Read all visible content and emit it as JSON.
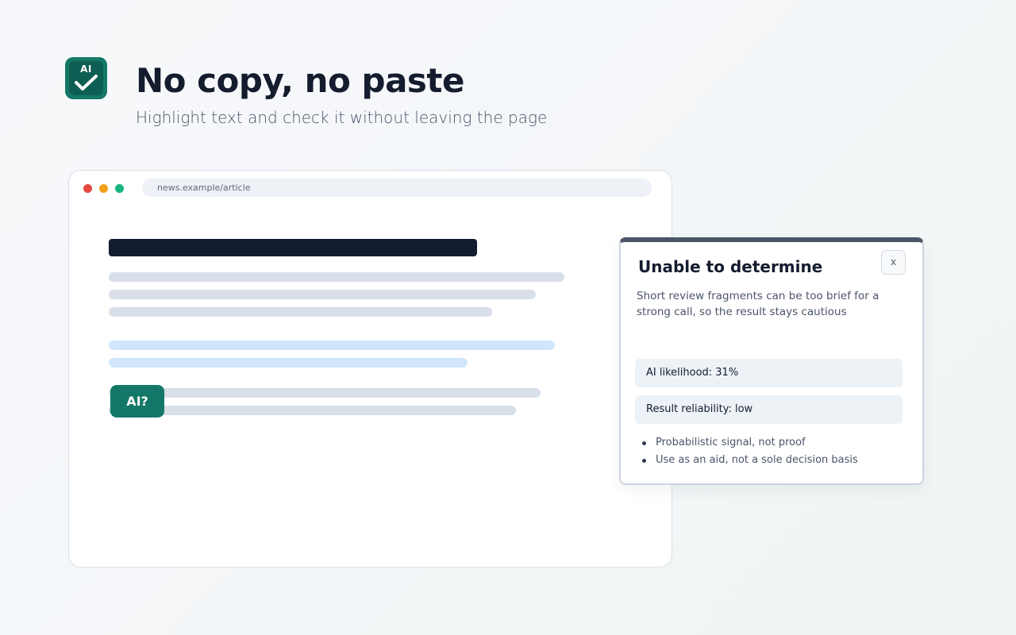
{
  "header": {
    "logo_text": "AI",
    "logo_icon": "checkmark-icon",
    "title": "No copy, no paste",
    "subtitle": "Highlight text and check it without leaving the page"
  },
  "browser": {
    "url": "news.example/article",
    "window_controls": [
      "close-dot",
      "minimize-dot",
      "maximize-dot"
    ],
    "ai_button_label": "AI?"
  },
  "popup": {
    "title": "Unable to determine",
    "close_label": "x",
    "description": "Short review fragments can be too brief for a strong call, so the result stays cautious",
    "stats": [
      {
        "label": "AI likelihood: 31%"
      },
      {
        "label": "Result reliability: low"
      }
    ],
    "notes": [
      "Probabilistic signal, not proof",
      "Use as an aid, not a sole decision basis"
    ]
  },
  "colors": {
    "brand": "#137868",
    "headline": "#141c2e",
    "popup_accent": "#4a5566",
    "highlight": "#d0e6fb"
  }
}
